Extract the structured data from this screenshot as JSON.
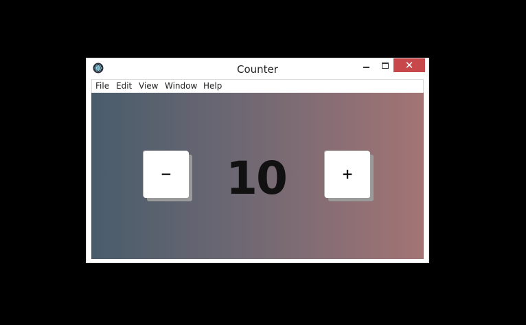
{
  "window": {
    "title": "Counter",
    "app_icon": "electron-icon",
    "controls": {
      "minimize_icon": "minimize-icon",
      "maximize_icon": "maximize-icon",
      "close_label": "✕"
    }
  },
  "menu": {
    "items": [
      {
        "label": "File"
      },
      {
        "label": "Edit"
      },
      {
        "label": "View"
      },
      {
        "label": "Window"
      },
      {
        "label": "Help"
      }
    ]
  },
  "counter": {
    "decrement_label": "−",
    "increment_label": "+",
    "value": "10"
  },
  "colors": {
    "gradient_left": "#495c6b",
    "gradient_right": "#a37474",
    "close_button": "#c7474a"
  }
}
